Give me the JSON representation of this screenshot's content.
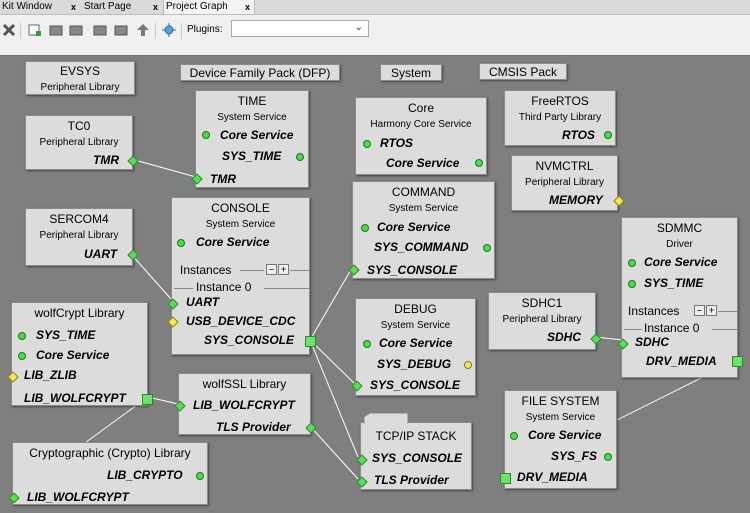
{
  "tabs": [
    {
      "label": "Kit Window",
      "close": "x"
    },
    {
      "label": "Start Page",
      "close": "x"
    },
    {
      "label": "Project Graph",
      "close": "x"
    }
  ],
  "toolbar": {
    "plugins_label": "Plugins:",
    "plugins_value": ""
  },
  "colors": {
    "canvas": "#7f7f7f",
    "node": "#dcdcdc",
    "port_green": "#4ed84e",
    "port_yellow": "#f5e36b"
  },
  "nodes": {
    "evsys": {
      "title": "EVSYS",
      "subtitle": "Peripheral Library"
    },
    "dfp": {
      "title": "Device Family Pack (DFP)"
    },
    "system": {
      "title": "System"
    },
    "cmsis": {
      "title": "CMSIS Pack"
    },
    "time": {
      "title": "TIME",
      "subtitle": "System Service",
      "p1": "Core Service",
      "p2": "SYS_TIME",
      "p3": "TMR"
    },
    "core": {
      "title": "Core",
      "subtitle": "Harmony Core Service",
      "p1": "RTOS",
      "p2": "Core Service"
    },
    "freertos": {
      "title": "FreeRTOS",
      "subtitle": "Third Party Library",
      "p1": "RTOS"
    },
    "tc0": {
      "title": "TC0",
      "subtitle": "Peripheral Library",
      "p1": "TMR"
    },
    "nvmctrl": {
      "title": "NVMCTRL",
      "subtitle": "Peripheral Library",
      "p1": "MEMORY"
    },
    "sercom4": {
      "title": "SERCOM4",
      "subtitle": "Peripheral Library",
      "p1": "UART"
    },
    "console": {
      "title": "CONSOLE",
      "subtitle": "System Service",
      "p1": "Core Service",
      "instances": "Instances",
      "instance0": "Instance 0",
      "p2": "UART",
      "p3": "USB_DEVICE_CDC",
      "p4": "SYS_CONSOLE"
    },
    "command": {
      "title": "COMMAND",
      "subtitle": "System Service",
      "p1": "Core Service",
      "p2": "SYS_COMMAND",
      "p3": "SYS_CONSOLE"
    },
    "sdmmc": {
      "title": "SDMMC",
      "subtitle": "Driver",
      "p1": "Core Service",
      "p2": "SYS_TIME",
      "instances": "Instances",
      "instance0": "Instance 0",
      "p3": "SDHC",
      "p4": "DRV_MEDIA"
    },
    "wolfcrypt": {
      "title": "wolfCrypt Library",
      "p1": "SYS_TIME",
      "p2": "Core Service",
      "p3": "LIB_ZLIB",
      "p4": "LIB_WOLFCRYPT"
    },
    "debug": {
      "title": "DEBUG",
      "subtitle": "System Service",
      "p1": "Core Service",
      "p2": "SYS_DEBUG",
      "p3": "SYS_CONSOLE"
    },
    "sdhc1": {
      "title": "SDHC1",
      "subtitle": "Peripheral Library",
      "p1": "SDHC"
    },
    "wolfssl": {
      "title": "wolfSSL Library",
      "p1": "LIB_WOLFCRYPT",
      "p2": "TLS Provider"
    },
    "filesystem": {
      "title": "FILE SYSTEM",
      "subtitle": "System Service",
      "p1": "Core Service",
      "p2": "SYS_FS",
      "p3": "DRV_MEDIA"
    },
    "crypto": {
      "title": "Cryptographic (Crypto) Library",
      "p1": "LIB_CRYPTO",
      "p2": "LIB_WOLFCRYPT"
    },
    "tcpip": {
      "title": "TCP/IP STACK",
      "p1": "SYS_CONSOLE",
      "p2": "TLS Provider"
    }
  }
}
